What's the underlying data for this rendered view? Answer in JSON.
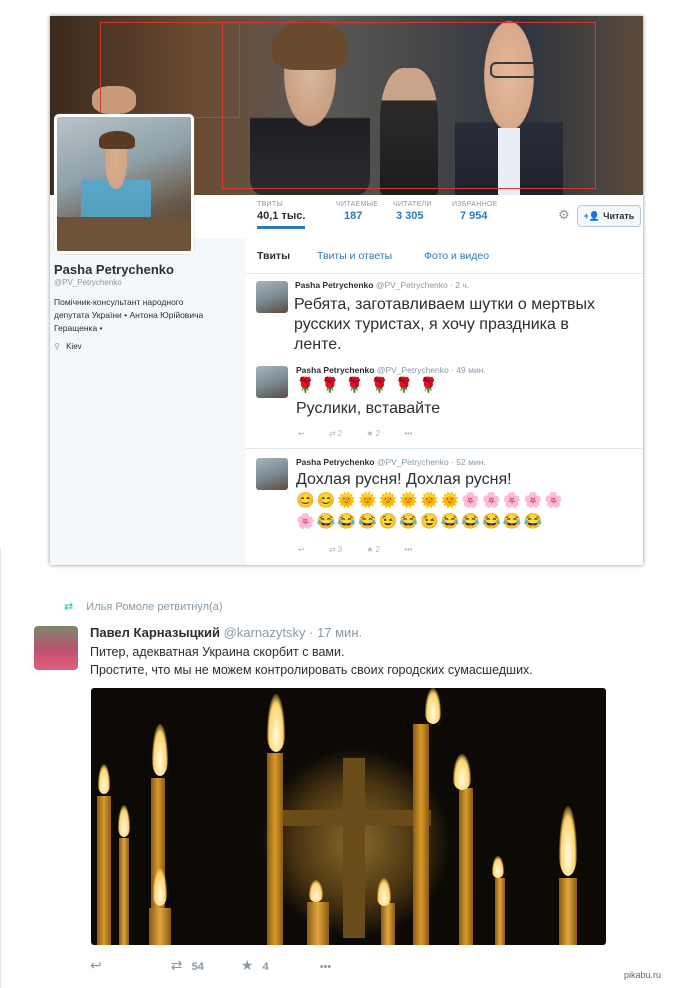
{
  "profile_screenshot": {
    "stats": [
      {
        "label": "ТВИТЫ",
        "value": "40,1 тыс."
      },
      {
        "label": "ЧИТАЕМЫЕ",
        "value": "187"
      },
      {
        "label": "ЧИТАТЕЛИ",
        "value": "3 305"
      },
      {
        "label": "ИЗБРАННОЕ",
        "value": "7 954"
      }
    ],
    "follow_label": "Читать",
    "profile": {
      "name": "Pasha Petrychenko",
      "handle": "@PV_Petrychenko",
      "bio_lines": [
        "Помічник-консультант народного",
        "депутата України • Антона Юрійовича",
        "Геращенка •"
      ],
      "location": "Kiev"
    },
    "tabs": [
      "Твиты",
      "Твиты и ответы",
      "Фото и видео"
    ],
    "tweets": [
      {
        "name": "Pasha Petrychenko",
        "meta": "@PV_Petrychenko · 2 ч.",
        "text_lines": [
          "Ребята, заготавливаем шутки о мертвых",
          "русских туристах, я хочу праздника в",
          "ленте."
        ]
      },
      {
        "name": "Pasha Petrychenko",
        "meta": "@PV_Petrychenko · 49 мин.",
        "emoji_line": "🌹🌹🌹🌹🌹🌹",
        "text_lines": [
          "Руслики, вставайте"
        ],
        "retweets": "2",
        "favorites": "2"
      },
      {
        "name": "Pasha Petrychenko",
        "meta": "@PV_Petrychenko · 52 мин.",
        "text_lines": [
          "Дохлая русня! Дохлая русня!"
        ],
        "emoji_line1": "😊😊🌞🌞🌞🌞🌞🌞🌸🌸🌸🌸🌸",
        "emoji_line2": "🌸😂😂😂😉😂😉😂😂😂😂😂",
        "retweets": "3",
        "favorites": "2"
      }
    ]
  },
  "bottom_tweet": {
    "retweet_line": "Илья Ромоле ретвитнул(а)",
    "name": "Павел Карназыцкий",
    "meta": "@karnazytsky · 17 мин.",
    "text_lines": [
      "Питер, адекватная  Украина скорбит с вами.",
      "Простите, что мы не можем контролировать своих городских сумасшедших."
    ],
    "retweets": "54",
    "favorites": "4"
  },
  "watermark": "pikabu.ru",
  "colors": {
    "link": "#2b7bb9",
    "muted": "#8899a6",
    "text": "#292f33",
    "border": "#e1e8ed"
  }
}
